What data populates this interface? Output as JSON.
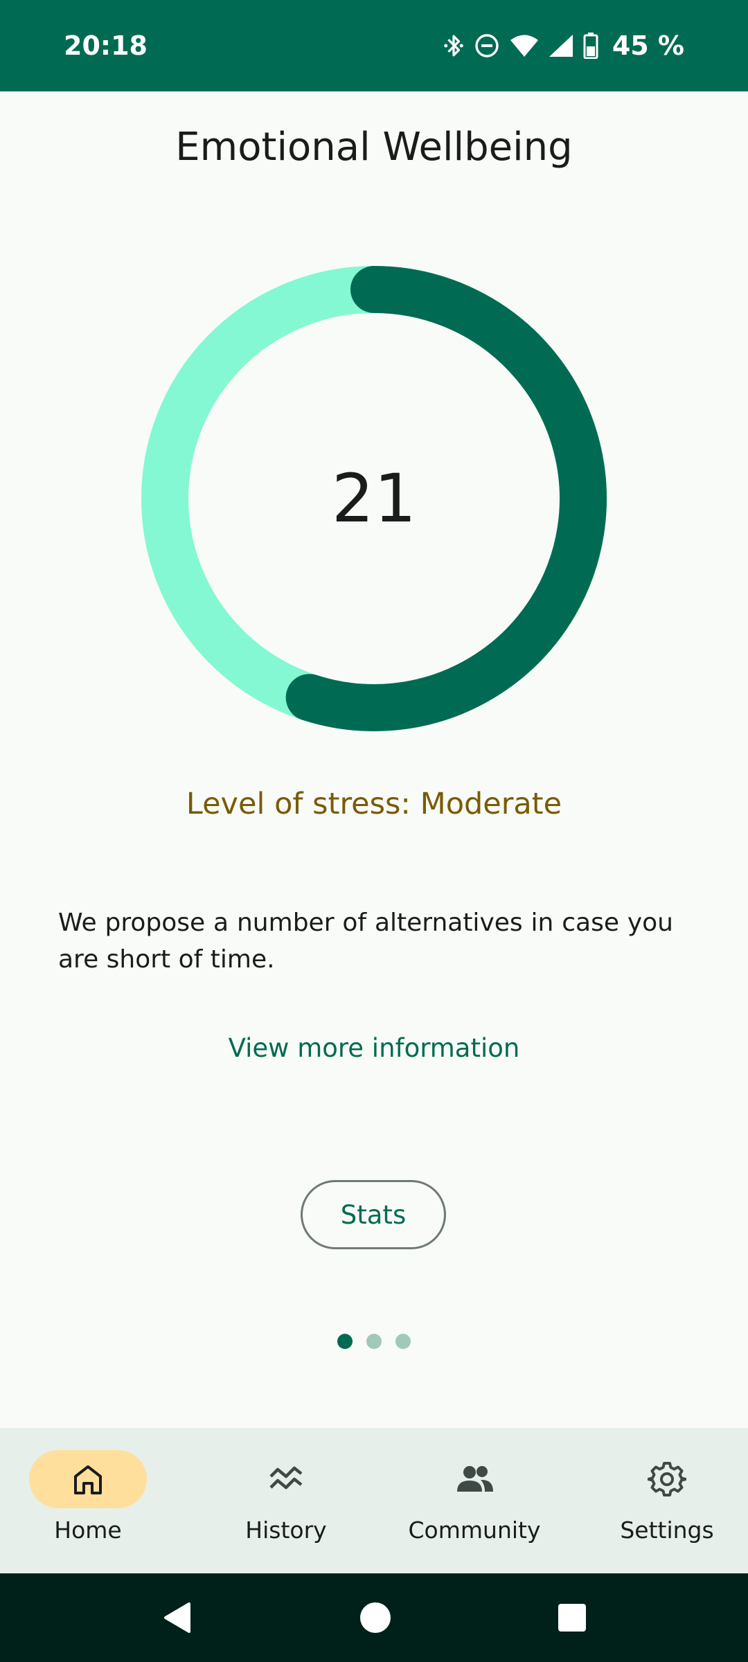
{
  "status_bar": {
    "time": "20:18",
    "battery": "45 %",
    "icons": [
      "bluetooth-icon",
      "do-not-disturb-icon",
      "wifi-icon",
      "signal-icon",
      "battery-icon"
    ]
  },
  "screen": {
    "title": "Emotional Wellbeing",
    "score": "21",
    "score_ring_fraction": 0.55,
    "stress_label": "Level of stress: Moderate",
    "description": "We propose a number of alternatives in case you are short of time.",
    "more_link": "View more information",
    "stats_button": "Stats",
    "page_indicator": {
      "count": 3,
      "active": 0
    }
  },
  "bottom_nav": {
    "items": [
      {
        "label": "Home",
        "icon": "home-icon",
        "active": true
      },
      {
        "label": "History",
        "icon": "history-icon",
        "active": false
      },
      {
        "label": "Community",
        "icon": "community-icon",
        "active": false
      },
      {
        "label": "Settings",
        "icon": "settings-icon",
        "active": false
      }
    ]
  },
  "colors": {
    "primary": "#006b52",
    "ring_track": "#84f8d2",
    "stress_text": "#7a5a05",
    "nav_active_pill": "#ffdf9b"
  }
}
